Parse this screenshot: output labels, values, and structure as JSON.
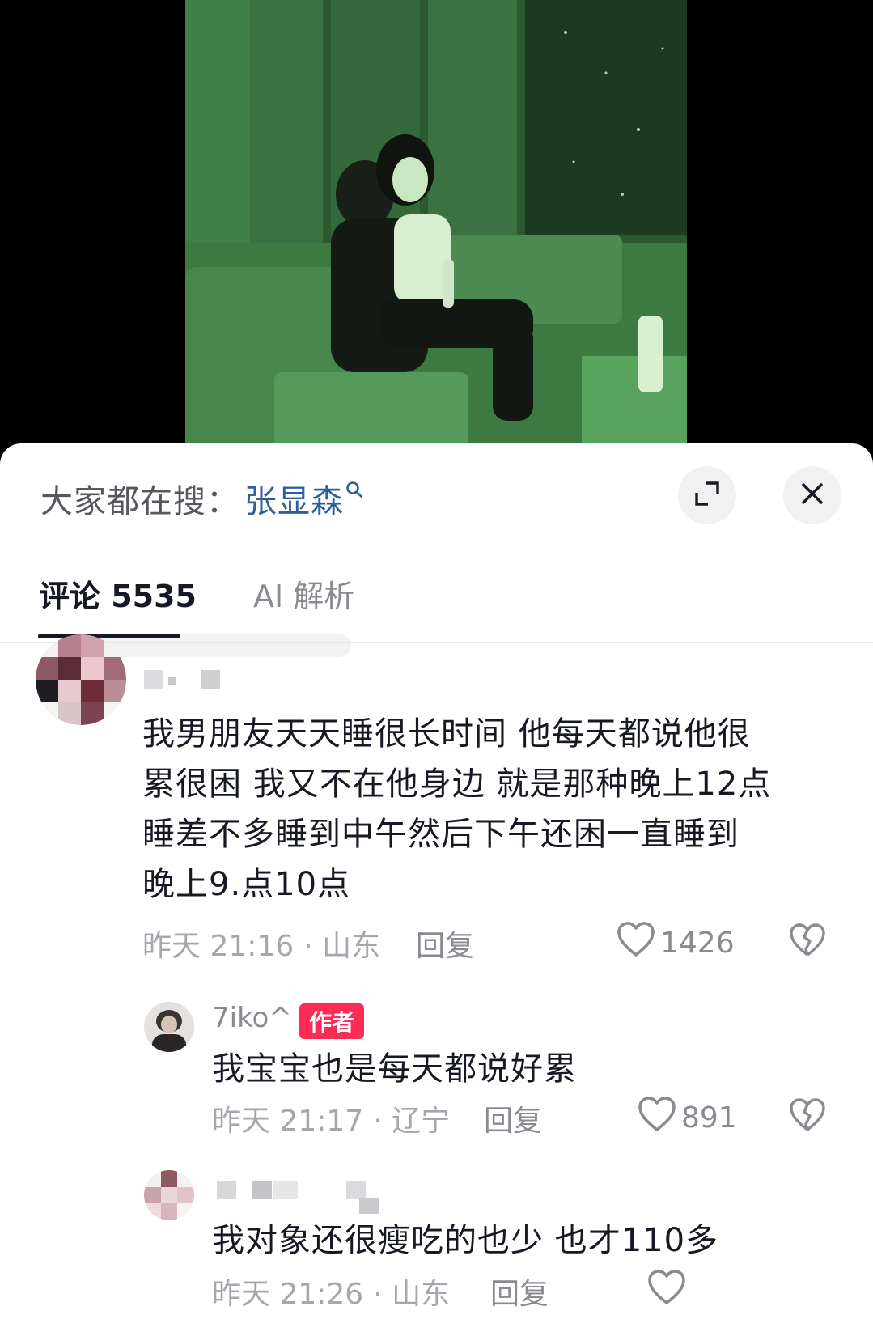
{
  "search": {
    "label": "大家都在搜：",
    "term": "张显森"
  },
  "tabs": [
    {
      "label": "评论 5535"
    },
    {
      "label": "AI 解析"
    }
  ],
  "comments": [
    {
      "text_lines": [
        "我男朋友天天睡很长时间 他每天都说他很",
        "累很困 我又不在他身边 就是那种晚上12点",
        "睡差不多睡到中午然后下午还困一直睡到",
        "晚上9.点10点"
      ],
      "time": "昨天 21:16",
      "location": "· 山东",
      "reply": "回复",
      "likes": "1426"
    },
    {
      "username": "7iko^",
      "badge": "作者",
      "text": "我宝宝也是每天都说好累",
      "time": "昨天 21:17",
      "location": "· 辽宁",
      "reply": "回复",
      "likes": "891"
    },
    {
      "text": "我对象还很瘦吃的也少 也才110多",
      "time": "昨天 21:26",
      "location": "· 山东",
      "reply": "回复"
    }
  ],
  "icons": {
    "search": "search-icon",
    "expand": "expand-icon",
    "close": "close-icon",
    "like": "heart-icon",
    "dislike": "broken-heart-icon"
  },
  "colors": {
    "search_term": "#2d5f9a",
    "author_badge": "#fe2c55",
    "video_tint": "#3f7a44"
  }
}
